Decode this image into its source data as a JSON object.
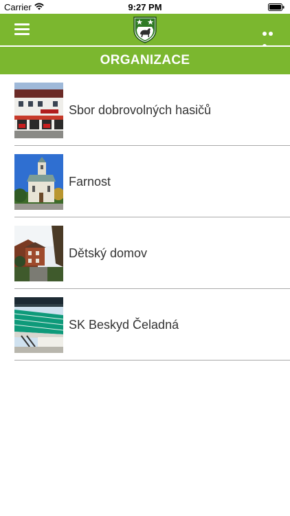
{
  "status_bar": {
    "carrier": "Carrier",
    "time": "9:27 PM",
    "wifi_icon": "wifi-icon",
    "battery_icon": "battery-icon"
  },
  "top_bar": {
    "background": "#7bb72f",
    "menu_icon": "hamburger-menu-icon",
    "logo": "municipal-crest-icon",
    "more_icon": "more-dots-icon"
  },
  "header": {
    "title": "ORGANIZACE"
  },
  "organizations": [
    {
      "name": "Sbor dobrovolných hasičů",
      "thumbnail": "fire-station-photo"
    },
    {
      "name": "Farnost",
      "thumbnail": "church-photo"
    },
    {
      "name": "Dětský domov",
      "thumbnail": "childrens-home-photo"
    },
    {
      "name": "SK Beskyd Čeladná",
      "thumbnail": "stadium-photo"
    }
  ]
}
